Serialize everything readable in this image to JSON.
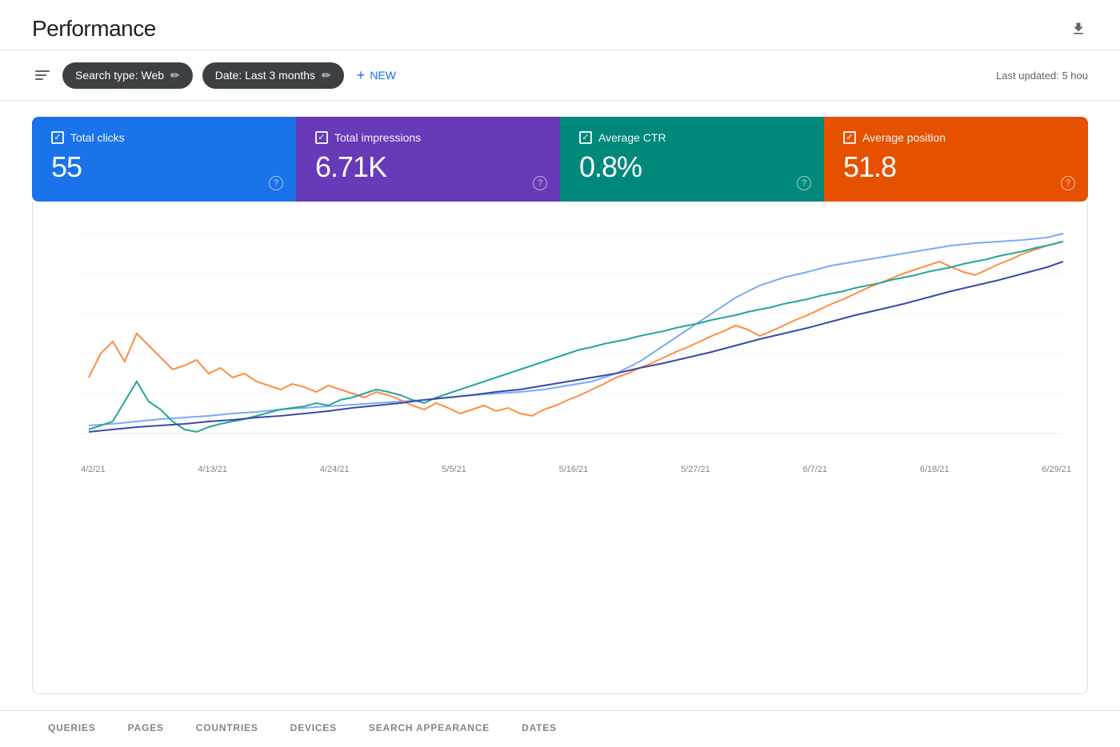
{
  "header": {
    "title": "Performance",
    "download_tooltip": "Download"
  },
  "toolbar": {
    "search_type_label": "Search type: Web",
    "date_label": "Date: Last 3 months",
    "new_button_label": "NEW",
    "last_updated": "Last updated: 5 hou"
  },
  "metrics": [
    {
      "id": "clicks",
      "label": "Total clicks",
      "value": "55",
      "color": "#1a73e8"
    },
    {
      "id": "impressions",
      "label": "Total impressions",
      "value": "6.71K",
      "color": "#673ab7"
    },
    {
      "id": "ctr",
      "label": "Average CTR",
      "value": "0.8%",
      "color": "#00897b"
    },
    {
      "id": "position",
      "label": "Average position",
      "value": "51.8",
      "color": "#e65100"
    }
  ],
  "chart": {
    "x_labels": [
      "4/2/21",
      "4/13/21",
      "4/24/21",
      "5/5/21",
      "5/16/21",
      "5/27/21",
      "6/7/21",
      "6/18/21",
      "6/29/21"
    ]
  },
  "bottom_tabs": [
    {
      "label": "QUERIES"
    },
    {
      "label": "PAGES"
    },
    {
      "label": "COUNTRIES"
    },
    {
      "label": "DEVICES"
    },
    {
      "label": "SEARCH APPEARANCE"
    },
    {
      "label": "DATES"
    }
  ]
}
